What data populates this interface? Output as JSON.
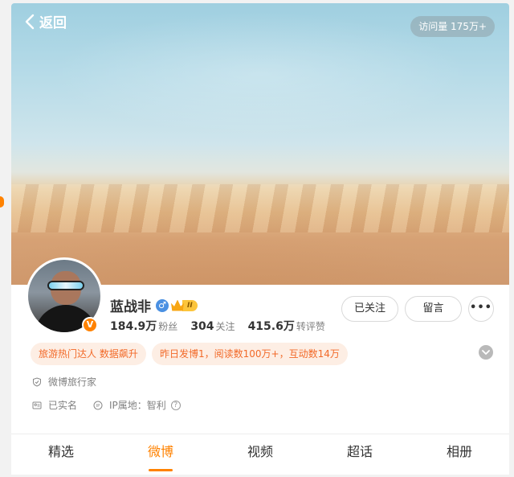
{
  "header": {
    "back_label": "返回",
    "visit_count": "访问量 175万+"
  },
  "profile": {
    "name": "蓝战非",
    "gender_symbol": "♂",
    "level_text": "II",
    "verified_mark": "V",
    "stats": [
      {
        "value": "184.9万",
        "label": "粉丝"
      },
      {
        "value": "304",
        "label": "关注"
      },
      {
        "value": "415.6万",
        "label": "转评赞"
      }
    ]
  },
  "actions": {
    "follow_label": "已关注",
    "message_label": "留言",
    "more_label": "•••"
  },
  "tags": [
    "旅游热门达人 数据飙升",
    "昨日发博1，阅读数100万+，互动数14万"
  ],
  "info": {
    "title": "微博旅行家",
    "verified": "已实名",
    "ip_location": "IP属地：智利",
    "help": "?"
  },
  "tabs": [
    {
      "label": "精选",
      "active": false
    },
    {
      "label": "微博",
      "active": true
    },
    {
      "label": "视频",
      "active": false
    },
    {
      "label": "超话",
      "active": false
    },
    {
      "label": "相册",
      "active": false
    }
  ],
  "colors": {
    "accent": "#ff8200",
    "tag_bg": "#fdeee4",
    "tag_text": "#f26a29",
    "gender_blue": "#4a90e2"
  }
}
